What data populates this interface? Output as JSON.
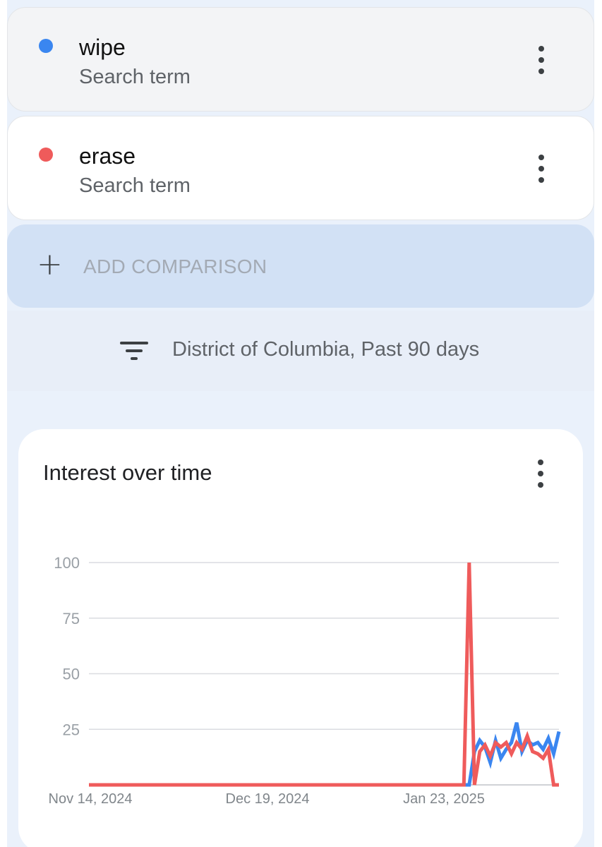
{
  "terms": [
    {
      "name": "wipe",
      "subtitle": "Search term",
      "color": "#3a86f0"
    },
    {
      "name": "erase",
      "subtitle": "Search term",
      "color": "#ef5b5b"
    }
  ],
  "add_comparison": {
    "label": "ADD COMPARISON"
  },
  "filter": {
    "text": "District of Columbia, Past 90 days"
  },
  "chart_card": {
    "title": "Interest over time"
  },
  "chart_data": {
    "type": "line",
    "title": "Interest over time",
    "xlabel": "",
    "ylabel": "",
    "ylim": [
      0,
      100
    ],
    "y_ticks": [
      100,
      75,
      50,
      25
    ],
    "x_tick_labels": [
      "Nov 14, 2024",
      "Dec 19, 2024",
      "Jan 23, 2025"
    ],
    "x_range": [
      "2024-11-14",
      "2025-02-11"
    ],
    "grid": true,
    "series": [
      {
        "name": "wipe",
        "color": "#3a86f0",
        "x": [
          "2024-11-14",
          "2025-01-25",
          "2025-01-26",
          "2025-01-27",
          "2025-01-28",
          "2025-01-29",
          "2025-01-30",
          "2025-01-31",
          "2025-02-01",
          "2025-02-02",
          "2025-02-03",
          "2025-02-04",
          "2025-02-05",
          "2025-02-06",
          "2025-02-07",
          "2025-02-08",
          "2025-02-09",
          "2025-02-10",
          "2025-02-11"
        ],
        "values": [
          0,
          0,
          15,
          20,
          17,
          10,
          20,
          12,
          16,
          19,
          28,
          15,
          20,
          18,
          19,
          16,
          21,
          14,
          24
        ]
      },
      {
        "name": "erase",
        "color": "#ef5b5b",
        "x": [
          "2024-11-14",
          "2025-01-24",
          "2025-01-25",
          "2025-01-26",
          "2025-01-27",
          "2025-01-28",
          "2025-01-29",
          "2025-01-30",
          "2025-01-31",
          "2025-02-01",
          "2025-02-02",
          "2025-02-03",
          "2025-02-04",
          "2025-02-05",
          "2025-02-06",
          "2025-02-07",
          "2025-02-08",
          "2025-02-09",
          "2025-02-10",
          "2025-02-11"
        ],
        "values": [
          0,
          0,
          100,
          0,
          15,
          18,
          13,
          19,
          17,
          19,
          14,
          19,
          16,
          22,
          15,
          14,
          12,
          16,
          0,
          0
        ]
      }
    ]
  }
}
